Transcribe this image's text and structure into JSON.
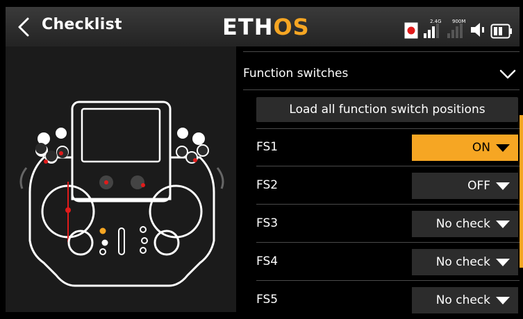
{
  "header": {
    "title": "Checklist",
    "logo_main": "ETH",
    "logo_accent": "OS",
    "status_24g": "2.4G",
    "status_900m": "900M"
  },
  "section": {
    "label": "Function switches"
  },
  "load_button": {
    "label": "Load all function switch positions"
  },
  "switches": [
    {
      "name": "FS1",
      "value": "ON"
    },
    {
      "name": "FS2",
      "value": "OFF"
    },
    {
      "name": "FS3",
      "value": "No check"
    },
    {
      "name": "FS4",
      "value": "No check"
    },
    {
      "name": "FS5",
      "value": "No check"
    }
  ],
  "colors": {
    "accent": "#f6a623",
    "header": "#2e2e2e",
    "button": "#2c2c2c",
    "record_red": "#e11b1b"
  }
}
